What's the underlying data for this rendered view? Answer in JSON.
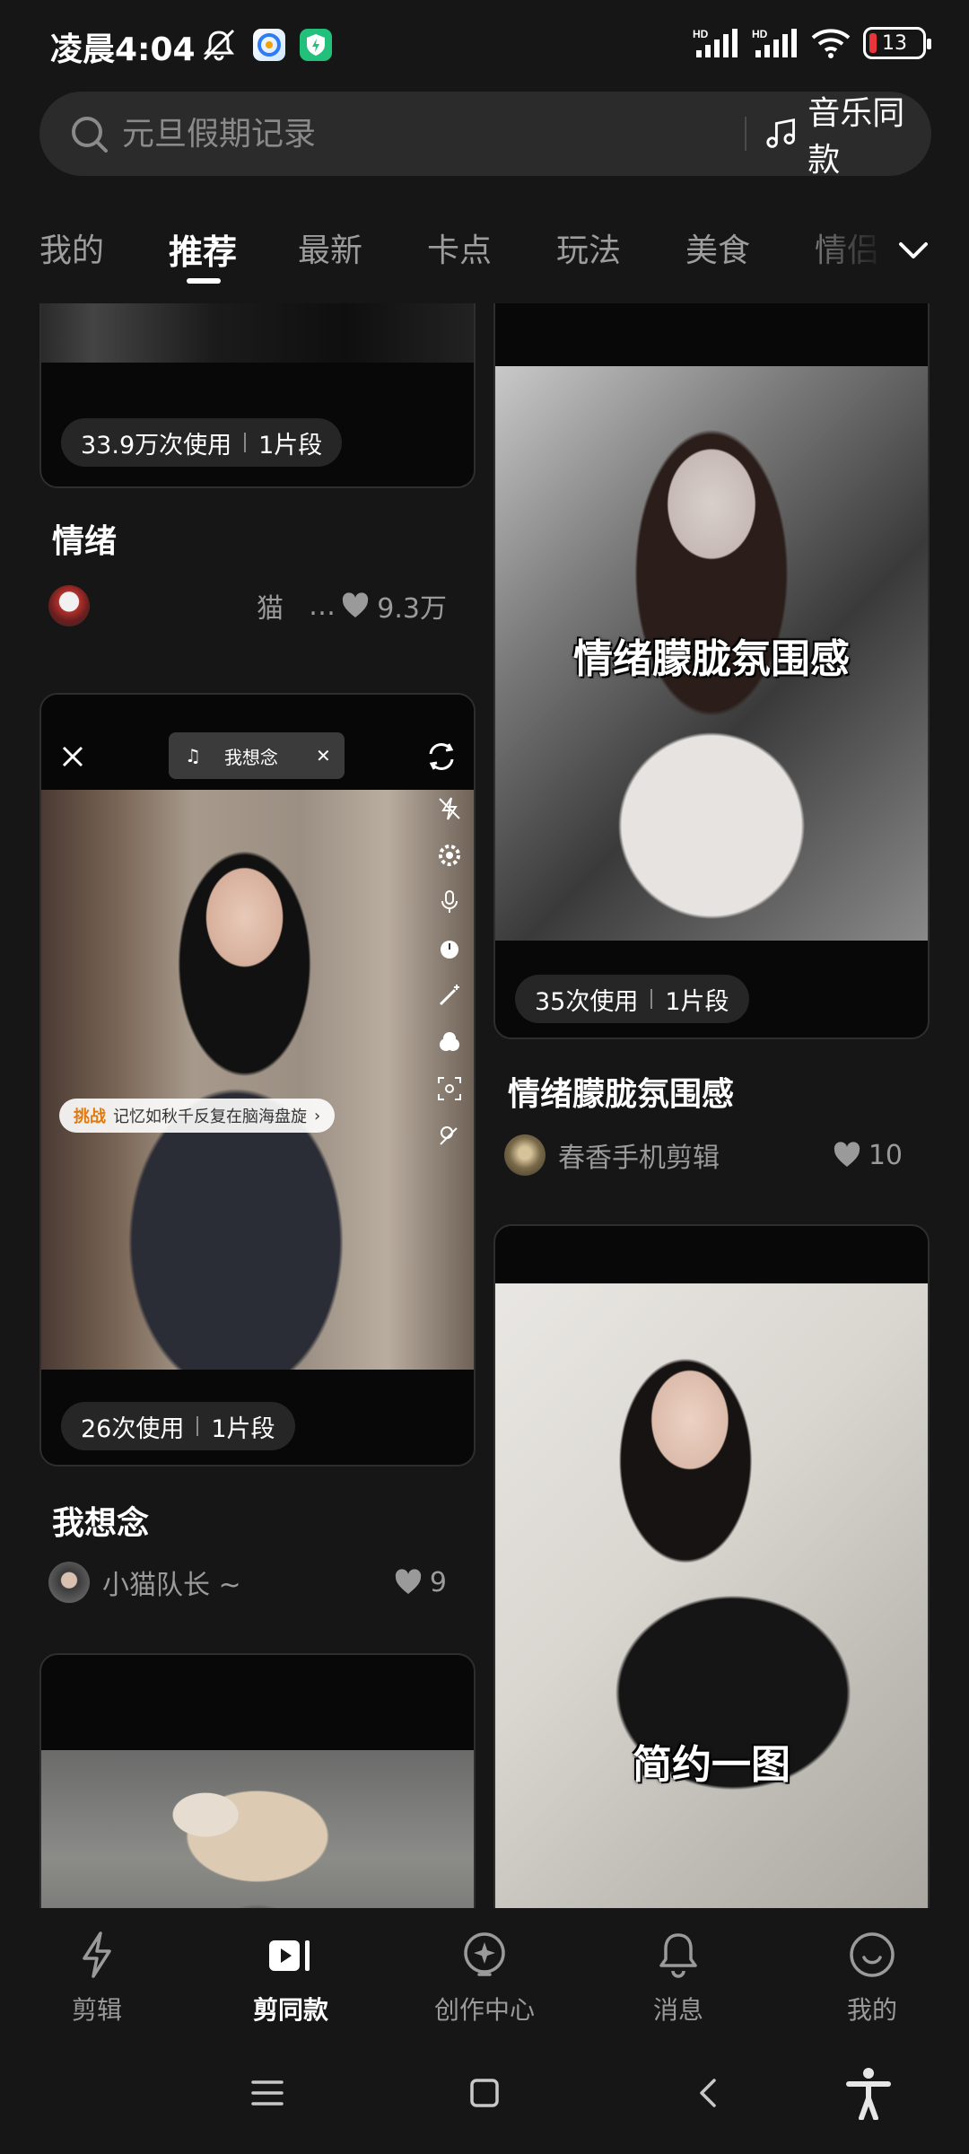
{
  "status_bar": {
    "time": "凌晨4:04",
    "signal_1": "HD",
    "signal_2": "HD",
    "battery": "13"
  },
  "search": {
    "placeholder": "元旦假期记录",
    "music_button": "音乐同款"
  },
  "tabs": [
    {
      "label": "我的"
    },
    {
      "label": "推荐"
    },
    {
      "label": "最新"
    },
    {
      "label": "卡点"
    },
    {
      "label": "玩法"
    },
    {
      "label": "美食"
    },
    {
      "label": "情侣"
    }
  ],
  "active_tab": "推荐",
  "cards": {
    "c1": {
      "usage": "33.9万次使用",
      "segments": "1片段",
      "title": "情绪",
      "author": "猫",
      "ellipsis": "…",
      "likes": "9.3万"
    },
    "c2": {
      "usage": "26次使用",
      "segments": "1片段",
      "title": "我想念",
      "author": "小猫队长 ~",
      "likes": "9",
      "music_pill": "我想念",
      "challenge_tag": "挑战",
      "challenge_text": "记忆如秋千反复在脑海盘旋"
    },
    "c3": {
      "overlay": "情绪朦胧氛围感",
      "usage": "35次使用",
      "segments": "1片段",
      "title": "情绪朦胧氛围感",
      "author": "春香手机剪辑",
      "likes": "10"
    },
    "c4": {
      "overlay": "简约一图"
    }
  },
  "bottom_nav": [
    {
      "label": "剪辑",
      "icon": "bolt-icon"
    },
    {
      "label": "剪同款",
      "icon": "play-icon"
    },
    {
      "label": "创作中心",
      "icon": "lightbulb-icon"
    },
    {
      "label": "消息",
      "icon": "bell-icon"
    },
    {
      "label": "我的",
      "icon": "smile-icon"
    }
  ],
  "active_nav": "剪同款",
  "colors": {
    "background": "#161616",
    "card": "#080808",
    "search_bg": "#2b2b2b",
    "muted_text": "#9a9a9a",
    "battery_low": "#e8353a"
  }
}
